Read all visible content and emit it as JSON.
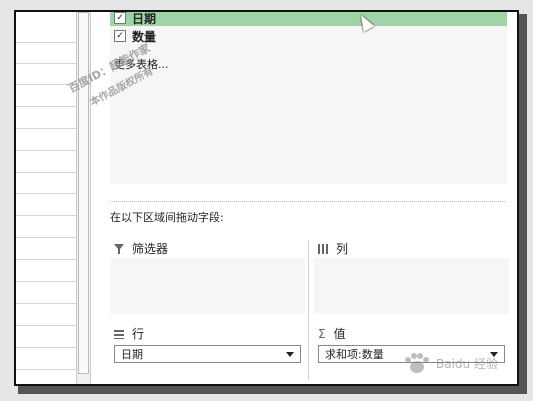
{
  "field_list": {
    "items": [
      {
        "label": "日期",
        "checked": true,
        "selected": true
      },
      {
        "label": "数量",
        "checked": true,
        "selected": false
      }
    ],
    "more_tables": "更多表格..."
  },
  "instruction": "在以下区域间拖动字段:",
  "areas": {
    "filters": {
      "label": "筛选器",
      "icon": "filter-icon"
    },
    "columns": {
      "label": "列",
      "icon": "columns-icon"
    },
    "rows": {
      "label": "行",
      "icon": "rows-icon",
      "value": "日期"
    },
    "values": {
      "label": "值",
      "icon": "sigma-icon",
      "value": "求和项:数量"
    }
  },
  "watermark": {
    "line1": "百度ID：超能作家",
    "line2": "本作品版权所有"
  },
  "colors": {
    "selected_row": "#9fd5a6",
    "area_bg": "#f6f6f6"
  },
  "brand": "Baidu 经验"
}
